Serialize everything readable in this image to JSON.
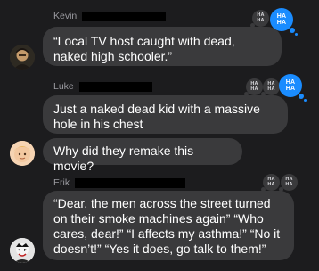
{
  "messages": [
    {
      "sender": "Kevin",
      "text": "“Local TV host caught with dead, naked high schooler.”",
      "reactions": [
        {
          "label": "HA HA",
          "style": "grey"
        },
        {
          "label": "HA HA",
          "style": "blue"
        }
      ]
    },
    {
      "sender": "Luke",
      "text": "Just a naked dead kid with a massive hole in his chest",
      "reactions": [
        {
          "label": "HA HA",
          "style": "grey"
        },
        {
          "label": "HA HA",
          "style": "grey"
        },
        {
          "label": "HA HA",
          "style": "blue"
        }
      ]
    },
    {
      "sender": "",
      "text": "Why did they remake this movie?",
      "reactions": []
    },
    {
      "sender": "Erik",
      "text": "“Dear, the men across the street turned on their smoke machines again” “Who cares, dear!” “I affects my asthma!” “No it doesn’t!” “Yes it does, go talk to them!”",
      "reactions": [
        {
          "label": "HA HA",
          "style": "grey"
        },
        {
          "label": "HA HA",
          "style": "grey"
        }
      ]
    }
  ],
  "colors": {
    "background": "#1c1c1e",
    "bubble": "#3a3a3c",
    "accent": "#1a8cff",
    "name": "#9a9aa0"
  }
}
